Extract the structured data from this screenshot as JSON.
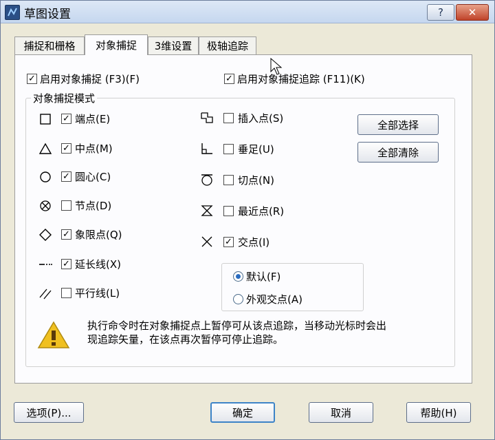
{
  "window": {
    "title": "草图设置",
    "help_label": "?",
    "close_label": "✕"
  },
  "tabs": [
    {
      "label": "捕捉和栅格",
      "active": false
    },
    {
      "label": "对象捕捉",
      "active": true
    },
    {
      "label": "3维设置",
      "active": false
    },
    {
      "label": "极轴追踪",
      "active": false
    }
  ],
  "top_options": {
    "enable_osnap": {
      "label": "启用对象捕捉 (F3)(F)",
      "checked": true
    },
    "enable_tracking": {
      "label": "启用对象捕捉追踪 (F11)(K)",
      "checked": true
    }
  },
  "modes_group": {
    "title": "对象捕捉模式",
    "left": [
      {
        "symbol": "square",
        "label": "端点(E)",
        "checked": true
      },
      {
        "symbol": "triangle",
        "label": "中点(M)",
        "checked": true
      },
      {
        "symbol": "circle",
        "label": "圆心(C)",
        "checked": true
      },
      {
        "symbol": "node",
        "label": "节点(D)",
        "checked": false
      },
      {
        "symbol": "diamond",
        "label": "象限点(Q)",
        "checked": true
      },
      {
        "symbol": "extension",
        "label": "延长线(X)",
        "checked": true
      },
      {
        "symbol": "parallel",
        "label": "平行线(L)",
        "checked": false
      }
    ],
    "right": [
      {
        "symbol": "insert",
        "label": "插入点(S)",
        "checked": false
      },
      {
        "symbol": "perpendicular",
        "label": "垂足(U)",
        "checked": false
      },
      {
        "symbol": "tangent",
        "label": "切点(N)",
        "checked": false
      },
      {
        "symbol": "nearest",
        "label": "最近点(R)",
        "checked": false
      },
      {
        "symbol": "intersection",
        "label": "交点(I)",
        "checked": true
      }
    ],
    "select_all_label": "全部选择",
    "clear_all_label": "全部清除",
    "intersection_radio": {
      "options": [
        {
          "label": "默认(F)",
          "selected": true
        },
        {
          "label": "外观交点(A)",
          "selected": false
        }
      ]
    }
  },
  "hint": {
    "icon": "warning-icon",
    "line1": "执行命令时在对象捕捉点上暂停可从该点追踪，当移动光标时会出",
    "line2": "现追踪矢量，在该点再次暂停可停止追踪。"
  },
  "footer": {
    "options_label": "选项(P)...",
    "ok_label": "确定",
    "cancel_label": "取消",
    "help_label": "帮助(H)"
  },
  "colors": {
    "accent": "#3c83c7",
    "warning": "#f0c020",
    "close": "#c0432a"
  }
}
